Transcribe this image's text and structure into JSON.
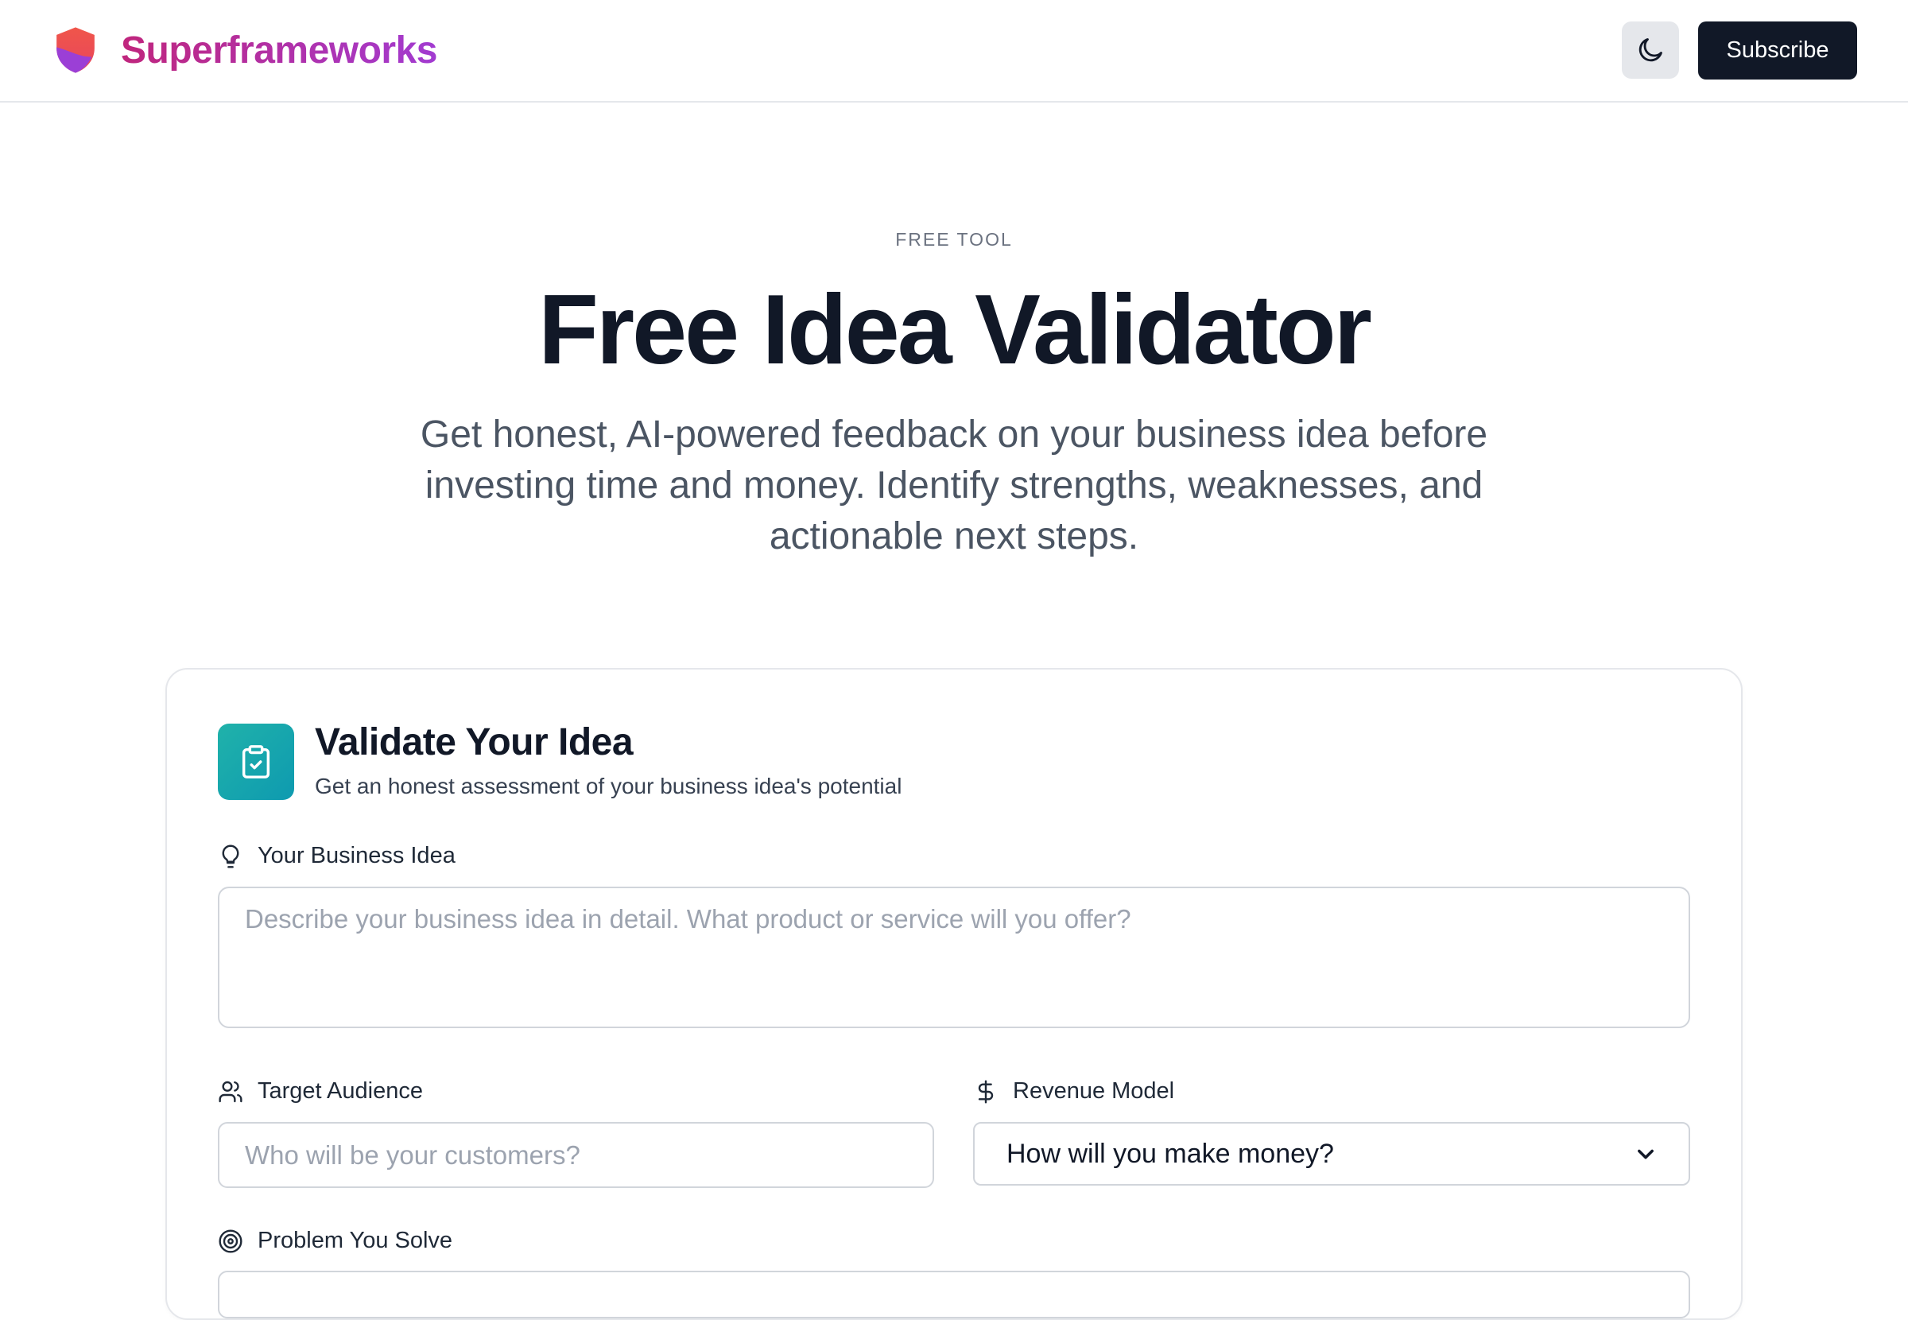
{
  "header": {
    "brand": "Superframeworks",
    "theme_toggle_icon": "moon-icon",
    "subscribe_label": "Subscribe"
  },
  "hero": {
    "eyebrow": "FREE TOOL",
    "title": "Free Idea Validator",
    "subtitle": "Get honest, AI-powered feedback on your business idea before investing time and money. Identify strengths, weaknesses, and actionable next steps."
  },
  "card": {
    "icon": "clipboard-check-icon",
    "title": "Validate Your Idea",
    "subtitle": "Get an honest assessment of your business idea's potential",
    "fields": {
      "idea": {
        "icon": "lightbulb-icon",
        "label": "Your Business Idea",
        "placeholder": "Describe your business idea in detail. What product or service will you offer?",
        "value": ""
      },
      "audience": {
        "icon": "users-icon",
        "label": "Target Audience",
        "placeholder": "Who will be your customers?",
        "value": ""
      },
      "revenue": {
        "icon": "dollar-icon",
        "label": "Revenue Model",
        "selected": "How will you make money?"
      },
      "problem": {
        "icon": "target-icon",
        "label": "Problem You Solve"
      }
    }
  },
  "colors": {
    "brand_gradient_start": "#c0267d",
    "brand_gradient_end": "#a23bd1",
    "primary_button": "#111827",
    "card_icon_bg": "#14a8ad"
  }
}
